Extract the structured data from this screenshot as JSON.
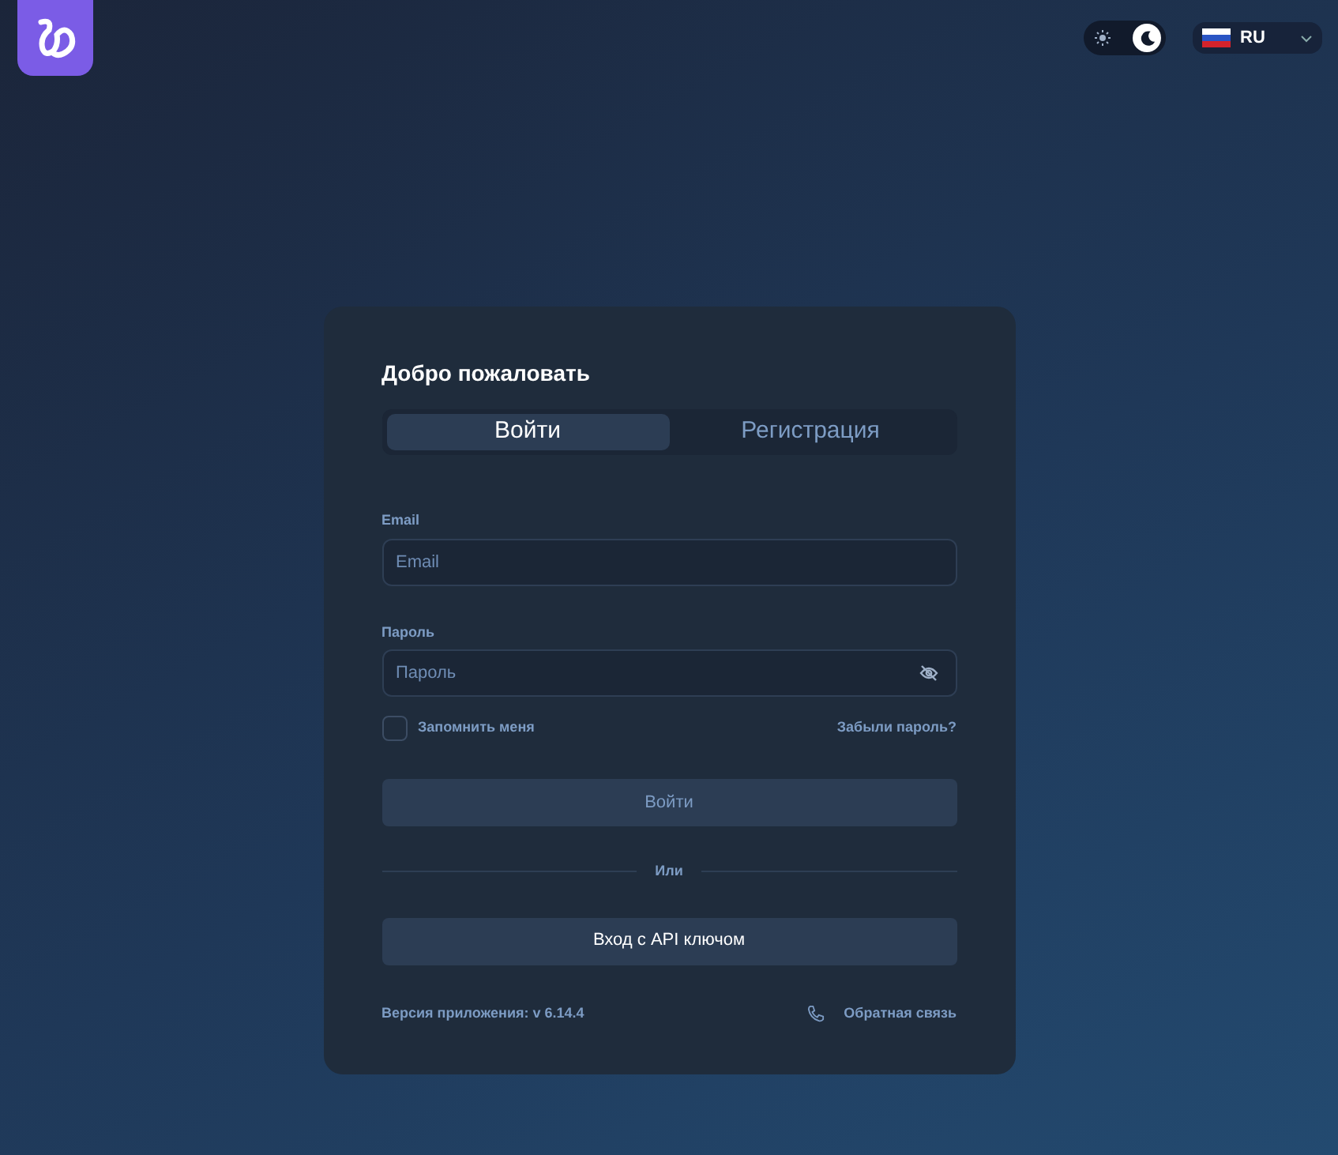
{
  "header": {
    "theme_toggle": {
      "dark": true
    },
    "language": {
      "code": "RU"
    }
  },
  "card": {
    "title": "Добро пожаловать",
    "tabs": [
      {
        "label": "Войти",
        "selected": true
      },
      {
        "label": "Регистрация",
        "selected": false
      }
    ],
    "fields": [
      {
        "label": "Email",
        "placeholder": "Email",
        "kind": "text"
      },
      {
        "label": "Пароль",
        "placeholder": "Пароль",
        "kind": "password"
      }
    ],
    "remember": {
      "label": "Запомнить меня",
      "checked": false
    },
    "forgot": "Забыли пароль?",
    "submit": {
      "label": "Войти",
      "disabled": true
    },
    "divider": "Или",
    "api_button": "Вход с API ключом",
    "version": "Версия приложения: v 6.14.4",
    "feedback": "Обратная связь"
  }
}
